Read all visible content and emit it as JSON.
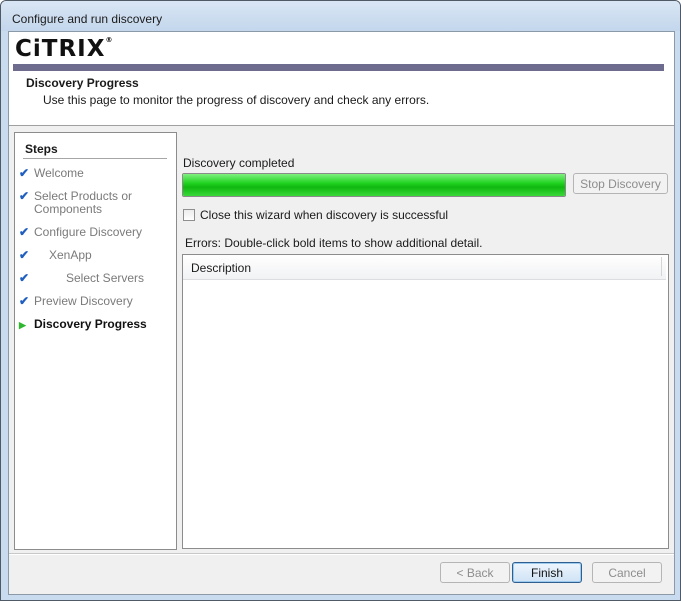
{
  "window": {
    "title": "Configure and run discovery"
  },
  "header": {
    "logo_text": "CiTRIX",
    "logo_mark": "®",
    "page_title": "Discovery Progress",
    "page_description": "Use this page to monitor the progress of discovery and check any errors.",
    "band_color": "#6e6c8e"
  },
  "steps": {
    "title": "Steps",
    "items": [
      {
        "label": "Welcome",
        "state": "done",
        "icon": "check-icon"
      },
      {
        "label": "Select Products or Components",
        "state": "done",
        "icon": "check-icon"
      },
      {
        "label": "Configure Discovery",
        "state": "done",
        "icon": "check-icon"
      },
      {
        "label": "XenApp",
        "state": "done",
        "icon": "check-icon"
      },
      {
        "label": "Select Servers",
        "state": "done",
        "icon": "check-icon"
      },
      {
        "label": "Preview Discovery",
        "state": "done",
        "icon": "check-icon"
      },
      {
        "label": "Discovery Progress",
        "state": "current",
        "icon": "arrow-right-icon"
      }
    ],
    "check_color": "#1f5fbf",
    "current_color": "#2fb82f"
  },
  "progress": {
    "status_label": "Discovery completed",
    "value_percent": 100,
    "bar_color": "#23d423",
    "stop_button_label": "Stop Discovery",
    "stop_button_enabled": false
  },
  "options": {
    "close_on_success_label": "Close this wizard when discovery is successful",
    "close_on_success_checked": false
  },
  "errors": {
    "label": "Errors: Double-click bold items to show additional detail.",
    "columns": [
      "Description"
    ],
    "rows": []
  },
  "footer": {
    "back_label": "< Back",
    "finish_label": "Finish",
    "cancel_label": "Cancel"
  }
}
